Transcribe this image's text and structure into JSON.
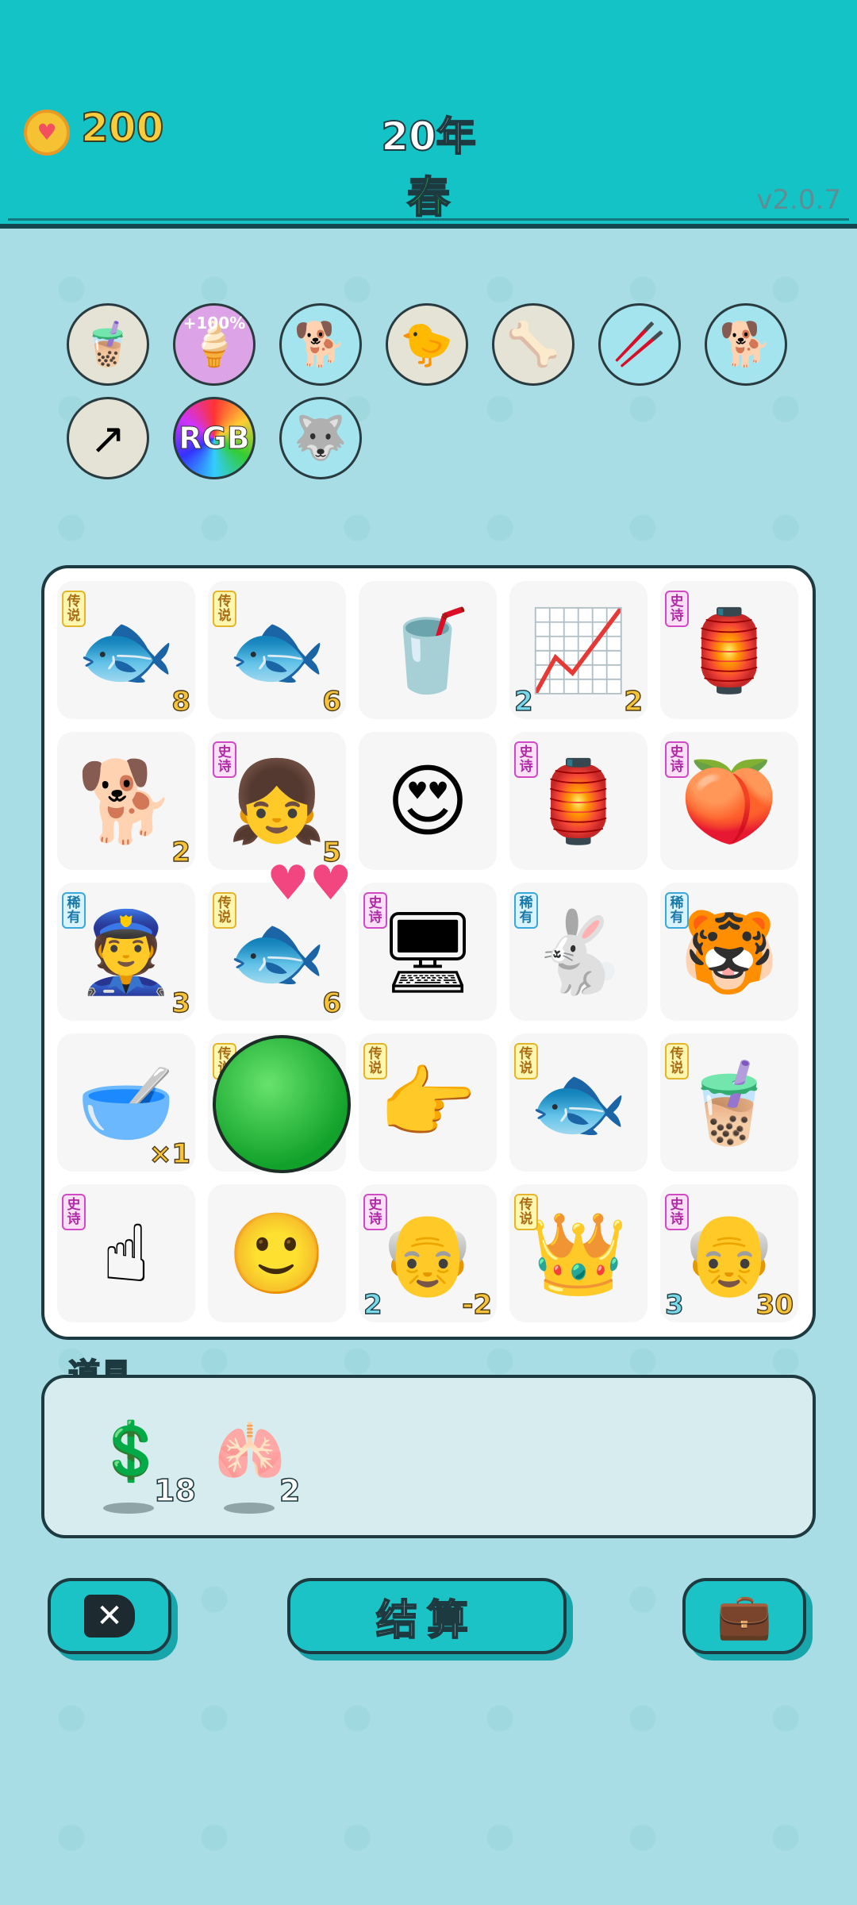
{
  "header": {
    "coins": "200",
    "year": "20年",
    "season": "春",
    "version": "v2.0.7"
  },
  "relics": [
    {
      "icon": "bubble-tea-icon",
      "glyph": "🧋",
      "bg": "#e5e2d6"
    },
    {
      "icon": "bubble-tea-boost-icon",
      "glyph": "🍦",
      "bg": "#dca3e6",
      "label": "+100%"
    },
    {
      "icon": "cool-dog-icon",
      "glyph": "🐕",
      "bg": "#a4e4ef"
    },
    {
      "icon": "chick-egg-icon",
      "glyph": "🐤",
      "bg": "#e5e2d6"
    },
    {
      "icon": "dog-bowl-icon",
      "glyph": "🦴",
      "bg": "#e5e2d6"
    },
    {
      "icon": "crossed-sticks-icon",
      "glyph": "🥢",
      "bg": "#a4e4ef"
    },
    {
      "icon": "cool-dog-icon",
      "glyph": "🐕",
      "bg": "#a4e4ef"
    },
    {
      "icon": "upgrade-arrow-icon",
      "glyph": "↗",
      "bg": "#e5e2d6"
    },
    {
      "icon": "rgb-ball-icon",
      "glyph": "",
      "bg": "rainbow",
      "label": "RGB"
    },
    {
      "icon": "husky-heart-icon",
      "glyph": "🐺",
      "bg": "#a4e4ef"
    }
  ],
  "board": [
    {
      "icon": "koi-fish-icon",
      "glyph": "🐟",
      "tag": "传说",
      "tagType": "leg",
      "br": "8"
    },
    {
      "icon": "koi-fish-icon",
      "glyph": "🐟",
      "tag": "传说",
      "tagType": "leg",
      "br": "6"
    },
    {
      "icon": "soda-cup-icon",
      "glyph": "🥤"
    },
    {
      "icon": "trend-chart-icon",
      "glyph": "📈",
      "bl": "2",
      "br": "2"
    },
    {
      "icon": "rabbit-house-icon",
      "glyph": "🏮",
      "tag": "史诗",
      "tagType": "epic"
    },
    {
      "icon": "husky-dog-icon",
      "glyph": "🐕",
      "br": "2"
    },
    {
      "icon": "braided-girl-icon",
      "glyph": "👧",
      "tag": "史诗",
      "tagType": "epic",
      "br": "5"
    },
    {
      "icon": "heart-eyes-man-icon",
      "glyph": "😍"
    },
    {
      "icon": "rabbit-house-icon",
      "glyph": "🏮",
      "tag": "史诗",
      "tagType": "epic"
    },
    {
      "icon": "peach-icon",
      "glyph": "🍑",
      "tag": "史诗",
      "tagType": "epic"
    },
    {
      "icon": "police-love-icon",
      "glyph": "👮",
      "tag": "稀有",
      "tagType": "rare",
      "br": "3"
    },
    {
      "icon": "koi-fish-icon",
      "glyph": "🐟",
      "tag": "传说",
      "tagType": "leg",
      "br": "6"
    },
    {
      "icon": "graphics-card-icon",
      "glyph": "🖥",
      "tag": "史诗",
      "tagType": "epic"
    },
    {
      "icon": "rabbit-icon",
      "glyph": "🐇",
      "tag": "稀有",
      "tagType": "rare"
    },
    {
      "icon": "tiger-icon",
      "glyph": "🐯",
      "tag": "稀有",
      "tagType": "rare"
    },
    {
      "icon": "bowl-icon",
      "glyph": "🥣",
      "br": "×1"
    },
    {
      "icon": "watermelon-icon",
      "glyph": "",
      "tag": "传说",
      "tagType": "leg"
    },
    {
      "icon": "pointing-hand-icon",
      "glyph": "👉",
      "tag": "传说",
      "tagType": "leg"
    },
    {
      "icon": "koi-fish-icon",
      "glyph": "🐟",
      "tag": "传说",
      "tagType": "leg"
    },
    {
      "icon": "bubble-tea-cup-icon",
      "glyph": "🧋",
      "tag": "传说",
      "tagType": "leg"
    },
    {
      "icon": "pointing-up-hand-icon",
      "glyph": "☝",
      "tag": "史诗",
      "tagType": "epic"
    },
    {
      "icon": "plain-man-icon",
      "glyph": "🙂"
    },
    {
      "icon": "old-man-icon",
      "glyph": "👴",
      "tag": "史诗",
      "tagType": "epic",
      "bl": "2",
      "br": "-2"
    },
    {
      "icon": "husky-king-icon",
      "glyph": "👑",
      "tag": "传说",
      "tagType": "leg"
    },
    {
      "icon": "old-man-icon",
      "glyph": "👴",
      "tag": "史诗",
      "tagType": "epic",
      "bl": "3",
      "br": "30"
    }
  ],
  "items": {
    "title": "道具",
    "list": [
      {
        "icon": "dollar-coin-icon",
        "glyph": "💲",
        "count": "18"
      },
      {
        "icon": "liver-icon",
        "glyph": "🫁",
        "count": "2"
      }
    ]
  },
  "buttons": {
    "settle_label": "结算"
  },
  "colors": {
    "header": "#14c3c6",
    "background": "#a8dde5",
    "gold": "#f7cd3c",
    "season": "#2fd24a"
  }
}
